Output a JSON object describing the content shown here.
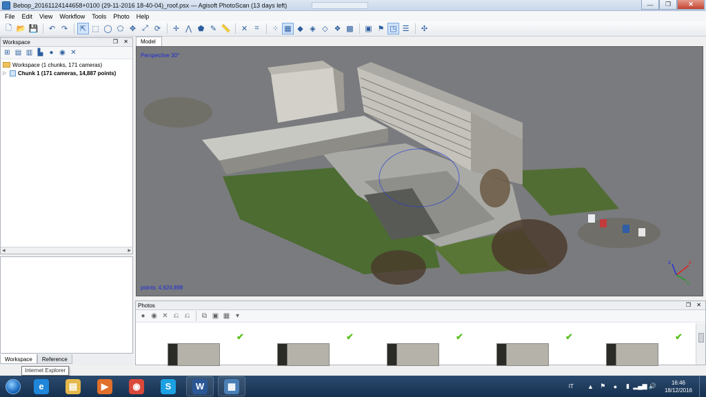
{
  "window": {
    "title": "Bebop_20161124144658+0100 (29-11-2016 18-40-04)_roof.psx — Agisoft PhotoScan (13 days left)",
    "minimize_icon": "minimize-icon",
    "restore_icon": "restore-icon",
    "close_icon": "close-icon",
    "minimize_glyph": "—",
    "restore_glyph": "❐",
    "close_glyph": "✕"
  },
  "menu": [
    "File",
    "Edit",
    "View",
    "Workflow",
    "Tools",
    "Photo",
    "Help"
  ],
  "toolbar": {
    "buttons": [
      {
        "name": "new-icon",
        "glyph": "🗋"
      },
      {
        "name": "open-icon",
        "glyph": "📂"
      },
      {
        "name": "save-icon",
        "glyph": "💾"
      },
      {
        "name": "sep"
      },
      {
        "name": "undo-icon",
        "glyph": "↶"
      },
      {
        "name": "redo-icon",
        "glyph": "↷"
      },
      {
        "name": "sep"
      },
      {
        "name": "navigation-icon",
        "glyph": "⇱",
        "active": true
      },
      {
        "name": "rectangle-selection-icon",
        "glyph": "⬚"
      },
      {
        "name": "circle-selection-icon",
        "glyph": "◯"
      },
      {
        "name": "free-form-selection-icon",
        "glyph": "⬠"
      },
      {
        "name": "move-region-icon",
        "glyph": "✥"
      },
      {
        "name": "resize-region-icon",
        "glyph": "⤢"
      },
      {
        "name": "rotate-region-icon",
        "glyph": "⟳"
      },
      {
        "name": "sep"
      },
      {
        "name": "ruler-icon",
        "glyph": "✛"
      },
      {
        "name": "draw-polyline-icon",
        "glyph": "⋀"
      },
      {
        "name": "draw-polygon-icon",
        "glyph": "⬟"
      },
      {
        "name": "draw-point-icon",
        "glyph": "✎"
      },
      {
        "name": "measure-icon",
        "glyph": "📏"
      },
      {
        "name": "sep"
      },
      {
        "name": "delete-selection-icon",
        "glyph": "✕"
      },
      {
        "name": "crop-selection-icon",
        "glyph": "⌗"
      },
      {
        "name": "sep"
      },
      {
        "name": "point-cloud-icon",
        "glyph": "⁘"
      },
      {
        "name": "dense-cloud-icon",
        "glyph": "▦",
        "active": true
      },
      {
        "name": "shaded-icon",
        "glyph": "◆"
      },
      {
        "name": "solid-icon",
        "glyph": "◈"
      },
      {
        "name": "wireframe-icon",
        "glyph": "◇"
      },
      {
        "name": "textured-icon",
        "glyph": "❖"
      },
      {
        "name": "tiled-model-icon",
        "glyph": "▩"
      },
      {
        "name": "sep"
      },
      {
        "name": "show-cameras-icon",
        "glyph": "▣"
      },
      {
        "name": "show-markers-icon",
        "glyph": "⚑"
      },
      {
        "name": "show-region-icon",
        "glyph": "◳",
        "active": true
      },
      {
        "name": "show-aligned-chunks-icon",
        "glyph": "☰"
      },
      {
        "name": "sep"
      },
      {
        "name": "reset-view-icon",
        "glyph": "✣"
      }
    ]
  },
  "workspace": {
    "header": "Workspace",
    "header_btns": "❐ ✕",
    "toolbar_icons": [
      {
        "name": "add-chunk-icon",
        "glyph": "⊞"
      },
      {
        "name": "add-photos-icon",
        "glyph": "▤"
      },
      {
        "name": "add-folder-icon",
        "glyph": "▥"
      },
      {
        "name": "batch-icon",
        "glyph": "▙"
      },
      {
        "name": "enable-icon",
        "glyph": "●"
      },
      {
        "name": "disable-icon",
        "glyph": "◉"
      },
      {
        "name": "remove-icon",
        "glyph": "✕"
      }
    ],
    "root_label": "Workspace (1 chunks, 171 cameras)",
    "chunk_label": "Chunk 1 (171 cameras, 14,887 points)",
    "tree_arrow": "▷",
    "scroll_left": "◀",
    "scroll_right": "▶"
  },
  "bottom_tabs": [
    "Workspace",
    "Reference"
  ],
  "tooltip": "Internet Explorer",
  "model": {
    "tab_label": "Model",
    "projection": "Perspective 30°",
    "points": "points: 4,624,898"
  },
  "photos": {
    "header": "Photos",
    "header_btns": "❐ ✕",
    "toolbar_icons": [
      {
        "name": "enable-cameras-icon",
        "glyph": "●"
      },
      {
        "name": "disable-cameras-icon",
        "glyph": "◉"
      },
      {
        "name": "remove-cameras-icon",
        "glyph": "✕"
      },
      {
        "name": "rotate-left-icon",
        "glyph": "⎌"
      },
      {
        "name": "rotate-right-icon",
        "glyph": "⎌"
      },
      {
        "name": "sep"
      },
      {
        "name": "reset-filter-icon",
        "glyph": "⧉"
      },
      {
        "name": "filter-icon",
        "glyph": "▣"
      },
      {
        "name": "view-mode-icon",
        "glyph": "▦"
      },
      {
        "name": "view-mode-dropdown-icon",
        "glyph": "▾"
      }
    ],
    "check_glyph": "✔",
    "thumbnail_count": 5
  },
  "taskbar": {
    "apps": [
      {
        "name": "internet-explorer-icon",
        "glyph": "e",
        "color": "#1f86d9"
      },
      {
        "name": "file-explorer-icon",
        "glyph": "▤",
        "color": "#e5b84b"
      },
      {
        "name": "media-player-icon",
        "glyph": "▶",
        "color": "#e0702a"
      },
      {
        "name": "chrome-icon",
        "glyph": "◉",
        "color": "#d9493b"
      },
      {
        "name": "skype-icon",
        "glyph": "S",
        "color": "#1ba1e2"
      },
      {
        "name": "word-icon",
        "glyph": "W",
        "color": "#2b5797"
      },
      {
        "name": "photoscan-taskbar-icon",
        "glyph": "▦",
        "color": "#4a7fb5"
      }
    ],
    "language": "IT",
    "tray_icons": [
      {
        "name": "show-hidden-icons-icon",
        "glyph": "▲"
      },
      {
        "name": "action-center-flag-icon",
        "glyph": "⚑"
      },
      {
        "name": "avast-icon",
        "glyph": "●"
      },
      {
        "name": "battery-icon",
        "glyph": "▮"
      },
      {
        "name": "network-icon",
        "glyph": "▂▄▆"
      },
      {
        "name": "volume-icon",
        "glyph": "🔊"
      }
    ],
    "time": "16:46",
    "date": "18/12/2016"
  }
}
